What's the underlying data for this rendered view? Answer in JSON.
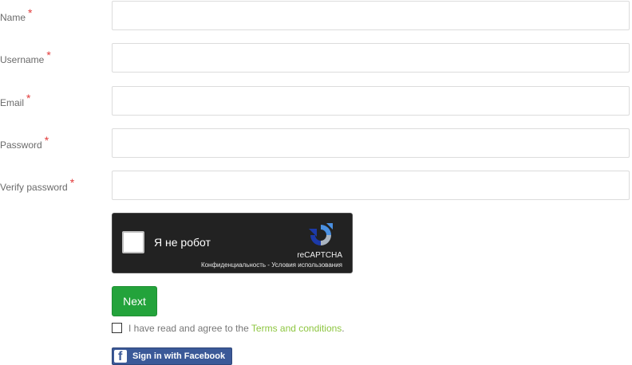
{
  "form": {
    "fields": [
      {
        "label": "Name",
        "required_mark": "*",
        "value": ""
      },
      {
        "label": "Username",
        "required_mark": "*",
        "value": ""
      },
      {
        "label": "Email",
        "required_mark": "*",
        "value": ""
      },
      {
        "label": "Password",
        "required_mark": "*",
        "value": ""
      },
      {
        "label": "Verify password",
        "required_mark": "*",
        "value": ""
      }
    ]
  },
  "recaptcha": {
    "checkbox_text": "Я не робот",
    "brand": "reCAPTCHA",
    "links": "Конфиденциальность - Условия использования"
  },
  "next_button": {
    "label": "Next"
  },
  "terms": {
    "text_before": "I have read and agree to the ",
    "link_text": "Terms and conditions",
    "text_after": "."
  },
  "facebook_button": {
    "label": "Sign in with Facebook"
  },
  "colors": {
    "next_bg": "#23a33b",
    "link": "#8ec641",
    "facebook": "#3b5998",
    "required": "#e23b3b"
  }
}
